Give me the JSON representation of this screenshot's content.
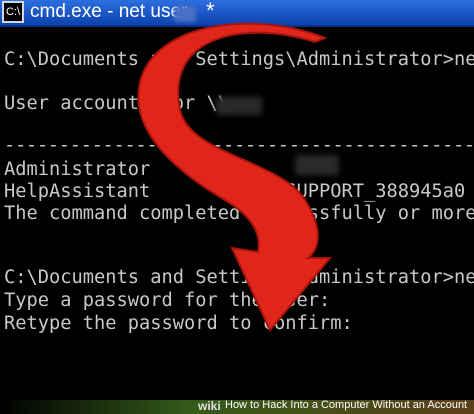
{
  "window": {
    "title": "cmd.exe - net user",
    "title_suffix": "*",
    "icon_label": "C:\\"
  },
  "console": {
    "lines": [
      "C:\\Documents and Settings\\Administrator>net",
      "User accounts for \\\\",
      "-------------------------------------------------",
      "Administrator",
      "HelpAssistant            SUPPORT_388945a0",
      "The command completed successfully or more error",
      "C:\\Documents and Settings\\Administrator>net",
      "Type a password for the user:",
      "Retype the password to confirm:"
    ]
  },
  "watermark": {
    "logo": "wiki",
    "caption": "How to Hack Into a Computer Without an Account"
  },
  "colors": {
    "console_text": "#c8c8c8",
    "titlebar": "#1b55c9",
    "arrow": "#e0261b"
  }
}
